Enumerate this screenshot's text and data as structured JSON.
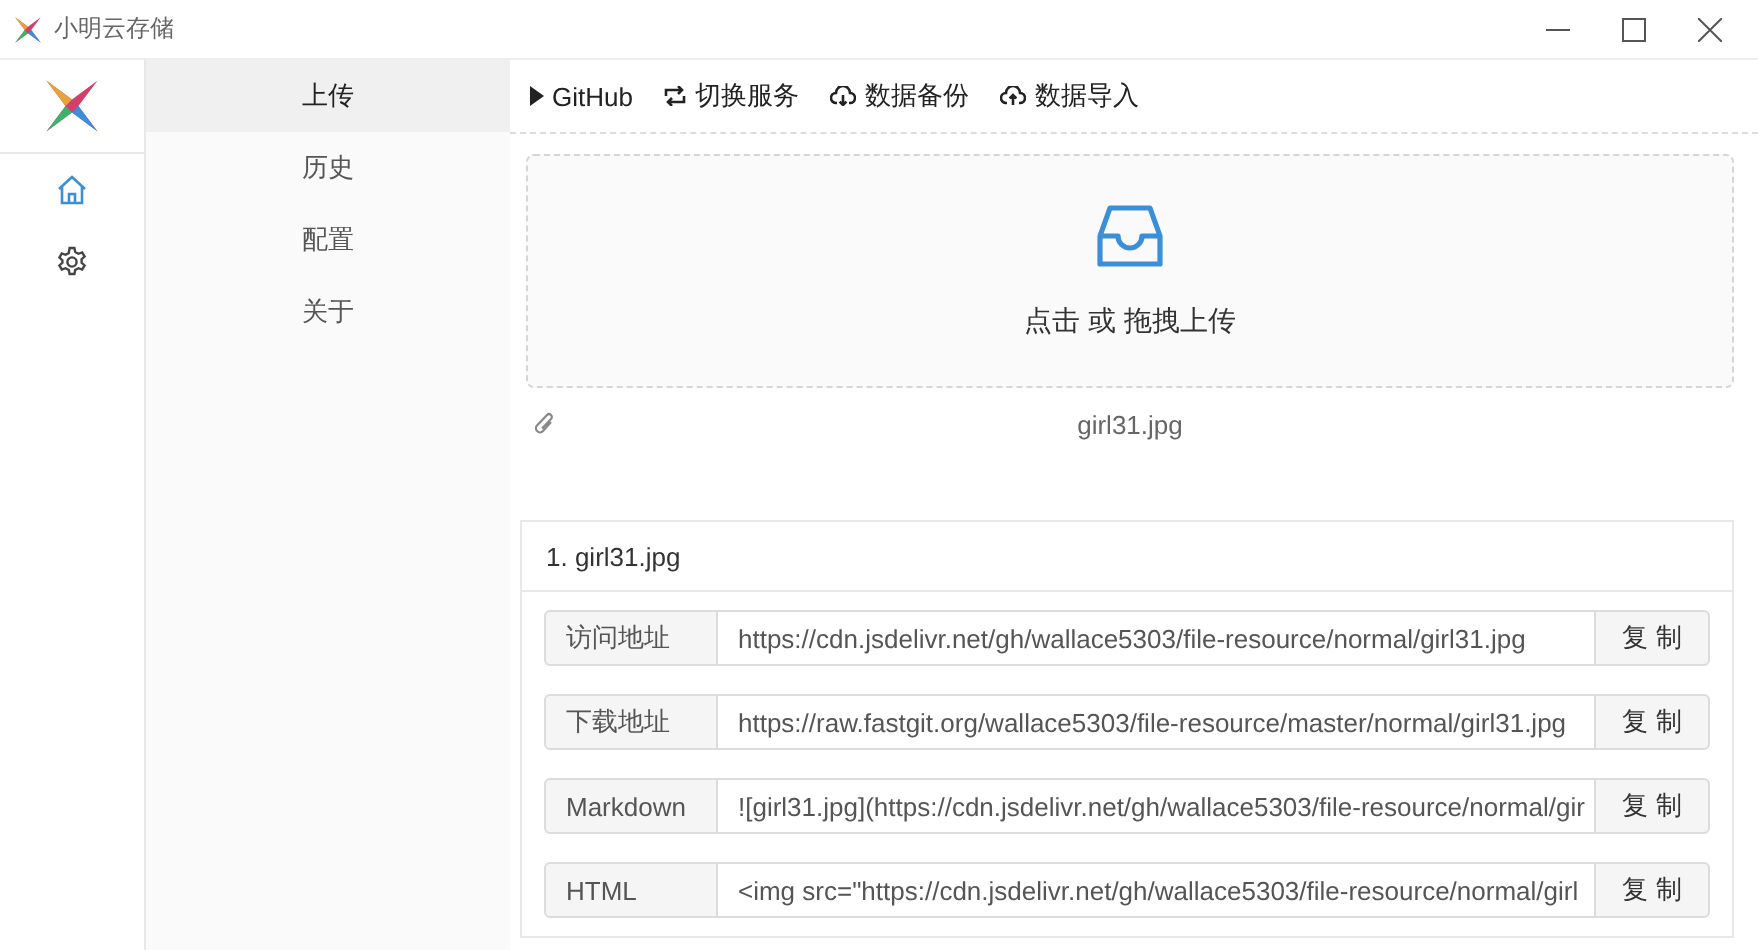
{
  "window": {
    "title": "小明云存储"
  },
  "rail": [
    {
      "kind": "home",
      "selected": true
    },
    {
      "kind": "settings",
      "selected": false
    }
  ],
  "menu": [
    {
      "label": "上传",
      "selected": true
    },
    {
      "label": "历史",
      "selected": false
    },
    {
      "label": "配置",
      "selected": false
    },
    {
      "label": "关于",
      "selected": false
    }
  ],
  "toolbar": [
    {
      "kind": "play",
      "label": "GitHub"
    },
    {
      "kind": "switch",
      "label": "切换服务"
    },
    {
      "kind": "cloud-down",
      "label": "数据备份"
    },
    {
      "kind": "cloud-up",
      "label": "数据导入"
    }
  ],
  "upload": {
    "text": "点击 或 拖拽上传",
    "file": "girl31.jpg"
  },
  "result": {
    "title": "1. girl31.jpg",
    "rows": [
      {
        "label": "访问地址",
        "value": "https://cdn.jsdelivr.net/gh/wallace5303/file-resource/normal/girl31.jpg",
        "button": "复 制"
      },
      {
        "label": "下载地址",
        "value": "https://raw.fastgit.org/wallace5303/file-resource/master/normal/girl31.jpg",
        "button": "复 制"
      },
      {
        "label": "Markdown",
        "value": "![girl31.jpg](https://cdn.jsdelivr.net/gh/wallace5303/file-resource/normal/gir",
        "button": "复 制"
      },
      {
        "label": "HTML",
        "value": "<img src=\"https://cdn.jsdelivr.net/gh/wallace5303/file-resource/normal/girl",
        "button": "复 制"
      }
    ]
  }
}
